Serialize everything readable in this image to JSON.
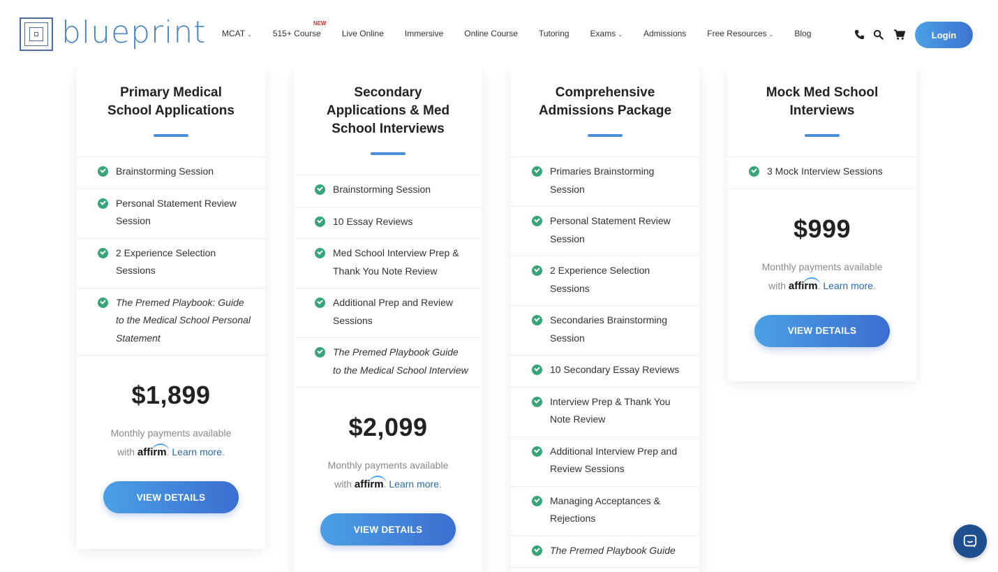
{
  "brand": {
    "name": "blueprint"
  },
  "nav": {
    "items": [
      {
        "label": "MCAT",
        "dropdown": true
      },
      {
        "label": "515+ Course",
        "badge": "NEW"
      },
      {
        "label": "Live Online"
      },
      {
        "label": "Immersive"
      },
      {
        "label": "Online Course"
      },
      {
        "label": "Tutoring"
      },
      {
        "label": "Exams",
        "dropdown": true
      },
      {
        "label": "Admissions"
      },
      {
        "label": "Free Resources",
        "dropdown": true
      },
      {
        "label": "Blog"
      }
    ],
    "login": "Login"
  },
  "affirm": {
    "monthly": "Monthly payments available",
    "with": "with",
    "logo": "affirm",
    "learn": "Learn more",
    "period": "."
  },
  "cards": [
    {
      "title": "Primary Medical School Applications",
      "features": [
        "Brainstorming Session",
        "Personal Statement Review Session",
        "2 Experience Selection Sessions",
        "The Premed Playbook: Guide to the Medical School Personal Statement"
      ],
      "price": "$1,899",
      "button": "VIEW DETAILS"
    },
    {
      "title": "Secondary Applications & Med School Interviews",
      "features": [
        "Brainstorming Session",
        "10 Essay Reviews",
        "Med School Interview Prep & Thank You Note Review",
        "Additional Prep and Review Sessions",
        "The Premed Playbook Guide to the Medical School Interview"
      ],
      "price": "$2,099",
      "button": "VIEW DETAILS"
    },
    {
      "title": "Comprehensive Admissions Package",
      "features": [
        "Primaries Brainstorming Session",
        "Personal Statement Review Session",
        "2 Experience Selection Sessions",
        "Secondaries Brainstorming Session",
        "10 Secondary Essay Reviews",
        "Interview Prep & Thank You Note Review",
        "Additional Interview Prep and Review Sessions",
        "Managing Acceptances & Rejections",
        "The Premed Playbook Guide"
      ]
    },
    {
      "title": "Mock Med School Interviews",
      "features": [
        "3 Mock Interview Sessions"
      ],
      "price": "$999",
      "button": "VIEW DETAILS"
    }
  ],
  "colors": {
    "accent": "#4a8fd8",
    "check": "#37a579",
    "button_start": "#4aa0e6",
    "button_end": "#3c6ed0",
    "chat": "#1f4f8f"
  },
  "icons": [
    "phone-icon",
    "search-icon",
    "cart-icon",
    "chat-icon",
    "check-icon",
    "chevron-down-icon"
  ]
}
